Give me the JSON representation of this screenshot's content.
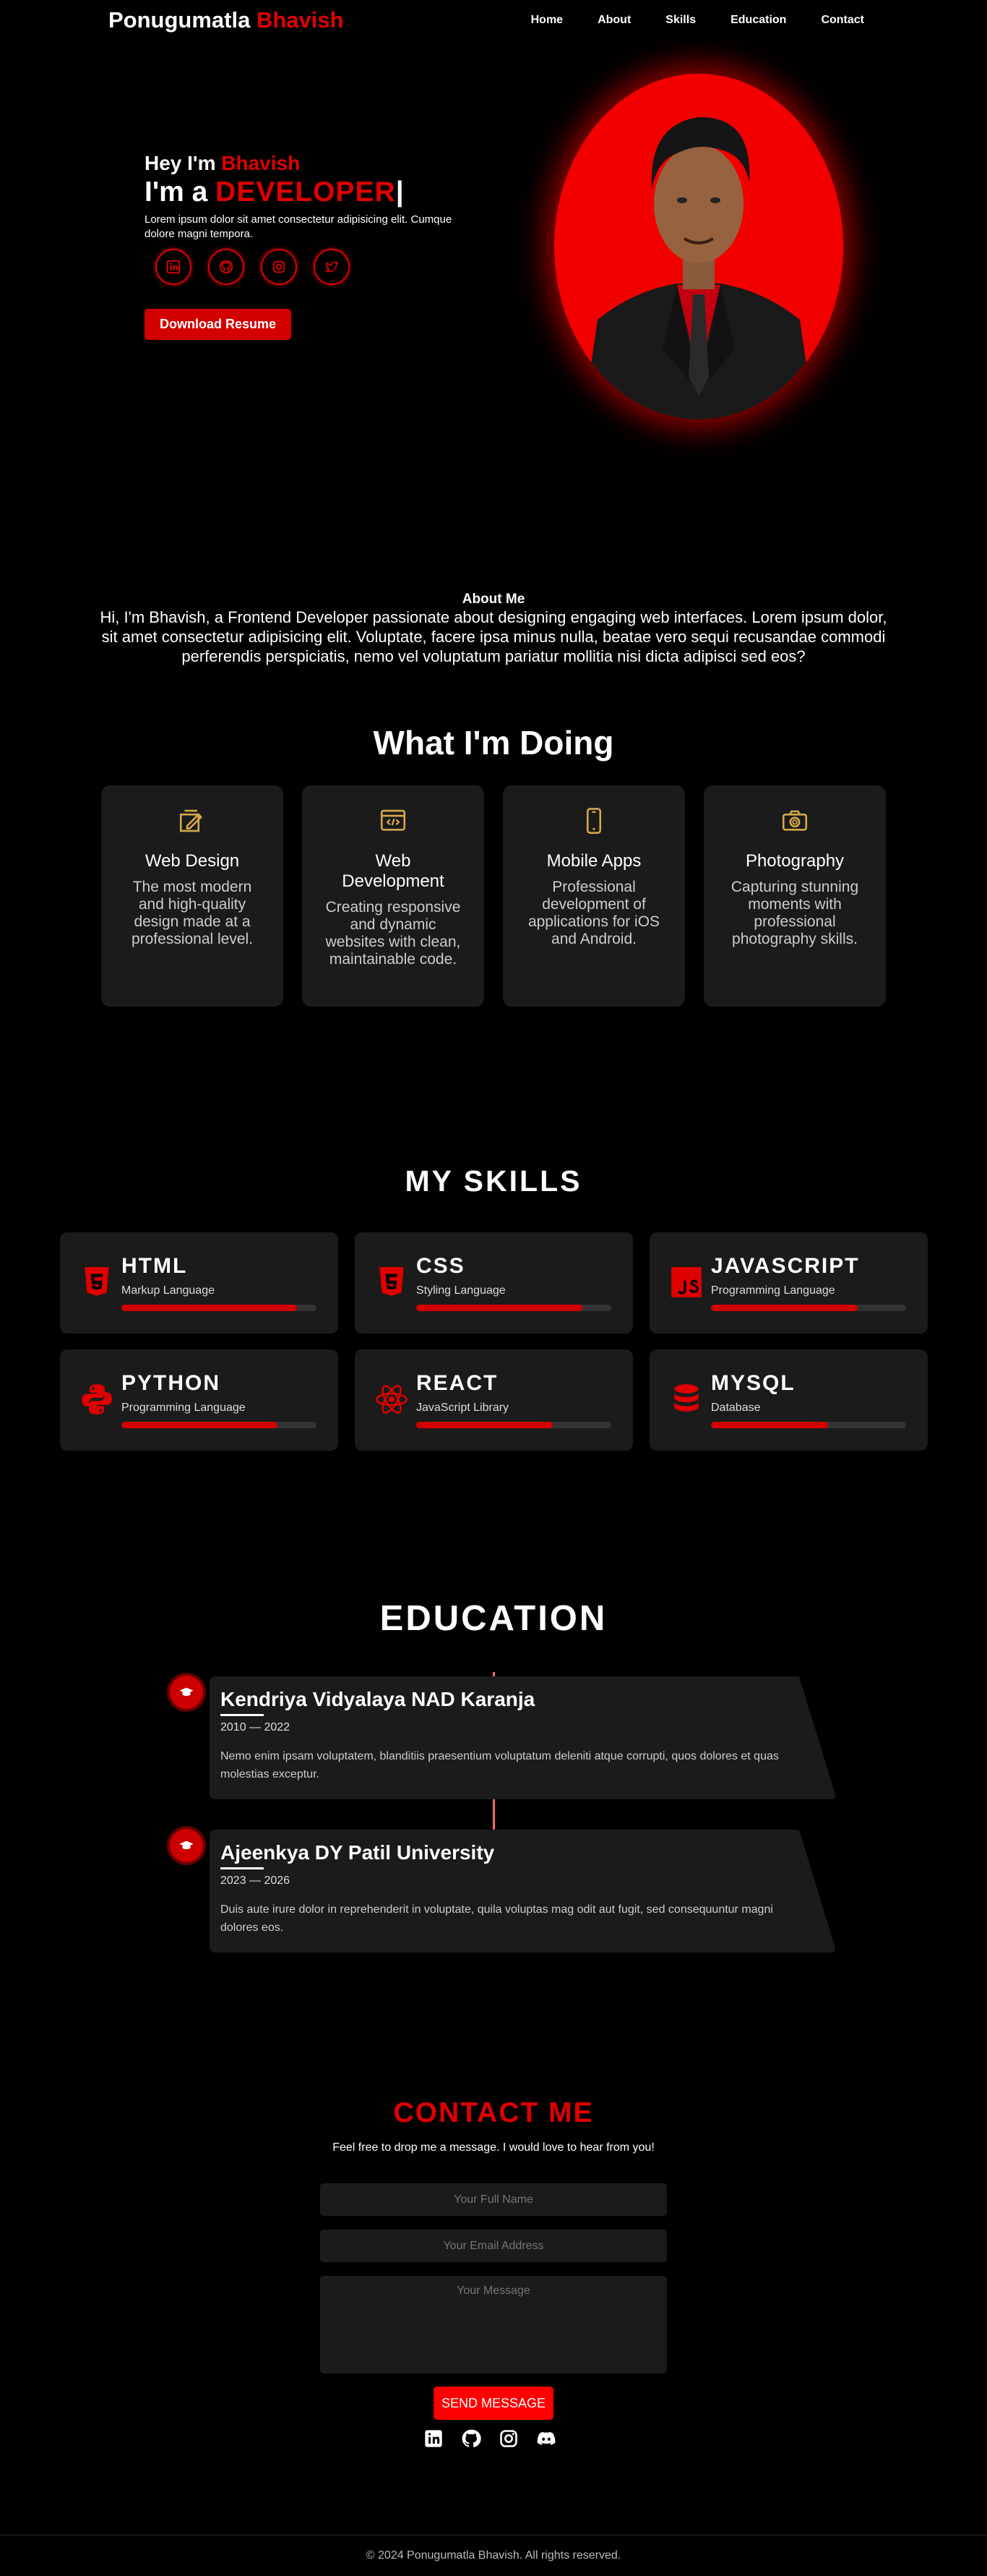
{
  "header": {
    "logo_first": "Ponugumatla",
    "logo_last": "Bhavish",
    "nav": [
      "Home",
      "About",
      "Skills",
      "Education",
      "Contact"
    ]
  },
  "hero": {
    "hey_prefix": "Hey I'm",
    "hey_name": "Bhavish",
    "iam_prefix": "I'm a",
    "role": "DEVELOPER",
    "cursor": "|",
    "description": "Lorem ipsum dolor sit amet consectetur adipisicing elit. Cumque dolore magni tempora.",
    "socials": [
      "linkedin-icon",
      "github-icon",
      "instagram-icon",
      "twitter-icon"
    ],
    "download_label": "Download Resume"
  },
  "about": {
    "heading": "About Me",
    "text": "Hi, I'm Bhavish, a Frontend Developer passionate about designing engaging web interfaces. Lorem ipsum dolor, sit amet consectetur adipisicing elit. Voluptate, facere ipsa minus nulla, beatae vero sequi recusandae commodi perferendis perspiciatis, nemo vel voluptatum pariatur mollitia nisi dicta adipisci sed eos?"
  },
  "doing": {
    "title": "What I'm Doing",
    "cards": [
      {
        "icon": "design-icon",
        "title": "Web Design",
        "text": "The most modern and high-quality design made at a professional level."
      },
      {
        "icon": "code-icon",
        "title": "Web Development",
        "text": "Creating responsive and dynamic websites with clean, maintainable code."
      },
      {
        "icon": "mobile-icon",
        "title": "Mobile Apps",
        "text": "Professional development of applications for iOS and Android."
      },
      {
        "icon": "camera-icon",
        "title": "Photography",
        "text": "Capturing stunning moments with professional photography skills."
      }
    ]
  },
  "skills": {
    "title": "MY SKILLS",
    "items": [
      {
        "name": "HTML",
        "sub": "Markup Language",
        "level": 0.9,
        "icon": "html5-icon"
      },
      {
        "name": "CSS",
        "sub": "Styling Language",
        "level": 0.85,
        "icon": "css3-icon"
      },
      {
        "name": "JAVASCRIPT",
        "sub": "Programming Language",
        "level": 0.75,
        "icon": "javascript-icon"
      },
      {
        "name": "PYTHON",
        "sub": "Programming Language",
        "level": 0.8,
        "icon": "python-icon"
      },
      {
        "name": "REACT",
        "sub": "JavaScript Library",
        "level": 0.7,
        "icon": "react-icon"
      },
      {
        "name": "MYSQL",
        "sub": "Database",
        "level": 0.6,
        "icon": "database-icon"
      }
    ]
  },
  "education": {
    "title": "EDUCATION",
    "items": [
      {
        "school": "Kendriya Vidyalaya NAD Karanja",
        "years": "2010 — 2022",
        "text": "Nemo enim ipsam voluptatem, blanditiis praesentium voluptatum deleniti atque corrupti, quos dolores et quas molestias exceptur."
      },
      {
        "school": "Ajeenkya DY Patil University",
        "years": "2023 — 2026",
        "text": "Duis aute irure dolor in reprehenderit in voluptate, quila voluptas mag odit aut fugit, sed consequuntur magni dolores eos."
      }
    ]
  },
  "contact": {
    "title": "CONTACT ME",
    "subtitle": "Feel free to drop me a message. I would love to hear from you!",
    "name_placeholder": "Your Full Name",
    "email_placeholder": "Your Email Address",
    "message_placeholder": "Your Message",
    "send_label": "SEND MESSAGE",
    "icons": [
      "linkedin-icon",
      "github-icon",
      "instagram-icon",
      "discord-icon"
    ]
  },
  "footer": {
    "text": "© 2024 Ponugumatla Bhavish. All rights reserved."
  },
  "colors": {
    "accent": "#e00000",
    "card": "#1b1b1b",
    "gold": "#d4a84a"
  }
}
